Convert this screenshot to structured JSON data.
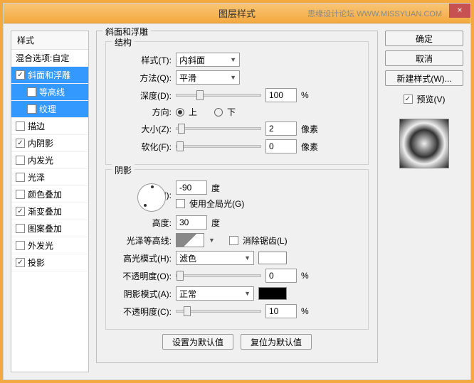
{
  "title": "图层样式",
  "watermark": "思缘设计论坛  WWW.MISSYUAN.COM",
  "sidebar": {
    "header": "样式",
    "blend": "混合选项:自定",
    "items": [
      {
        "label": "斜面和浮雕",
        "checked": true,
        "selected": true
      },
      {
        "label": "等高线",
        "checked": false,
        "sub": true,
        "selected": true
      },
      {
        "label": "纹理",
        "checked": false,
        "sub": true,
        "selected": true
      },
      {
        "label": "描边",
        "checked": false
      },
      {
        "label": "内阴影",
        "checked": true
      },
      {
        "label": "内发光",
        "checked": false
      },
      {
        "label": "光泽",
        "checked": false
      },
      {
        "label": "颜色叠加",
        "checked": false
      },
      {
        "label": "渐变叠加",
        "checked": true
      },
      {
        "label": "图案叠加",
        "checked": false
      },
      {
        "label": "外发光",
        "checked": false
      },
      {
        "label": "投影",
        "checked": true
      }
    ]
  },
  "panel": {
    "title": "斜面和浮雕",
    "struct": {
      "title": "结构",
      "style_l": "样式(T):",
      "style_v": "内斜面",
      "tech_l": "方法(Q):",
      "tech_v": "平滑",
      "depth_l": "深度(D):",
      "depth_v": "100",
      "depth_u": "%",
      "dir_l": "方向:",
      "dir_up": "上",
      "dir_down": "下",
      "size_l": "大小(Z):",
      "size_v": "2",
      "size_u": "像素",
      "soft_l": "软化(F):",
      "soft_v": "0",
      "soft_u": "像素"
    },
    "shade": {
      "title": "阴影",
      "angle_l": "角度(N):",
      "angle_v": "-90",
      "angle_u": "度",
      "global": "使用全局光(G)",
      "alt_l": "高度:",
      "alt_v": "30",
      "alt_u": "度",
      "gloss_l": "光泽等高线:",
      "aa": "消除锯齿(L)",
      "hmode_l": "高光模式(H):",
      "hmode_v": "滤色",
      "hop_l": "不透明度(O):",
      "hop_v": "0",
      "hop_u": "%",
      "smode_l": "阴影模式(A):",
      "smode_v": "正常",
      "sop_l": "不透明度(C):",
      "sop_v": "10",
      "sop_u": "%"
    }
  },
  "buttons": {
    "ok": "确定",
    "cancel": "取消",
    "newstyle": "新建样式(W)...",
    "preview": "预览(V)",
    "default": "设置为默认值",
    "reset": "复位为默认值"
  }
}
